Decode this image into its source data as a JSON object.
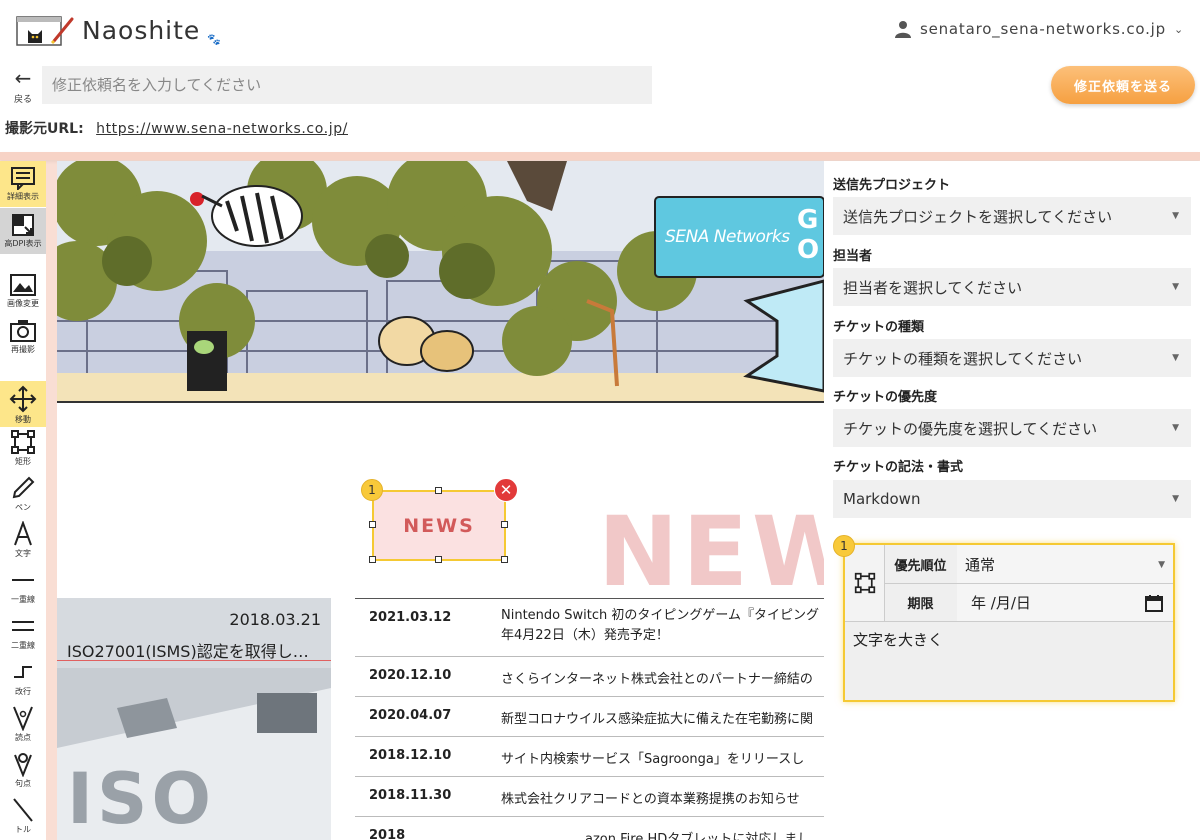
{
  "app": {
    "brand": "Naoshite",
    "user": "senataro_sena-networks.co.jp"
  },
  "toolbar_top": {
    "back_label": "戻る",
    "title_placeholder": "修正依頼名を入力してください",
    "send_label": "修正依頼を送る"
  },
  "source": {
    "label": "撮影元URL:",
    "url": "https://www.sena-networks.co.jp/"
  },
  "tools": [
    {
      "icon": "detail-view-icon",
      "label": "詳細表示"
    },
    {
      "icon": "high-dpi-icon",
      "label": "高DPI表示"
    },
    {
      "icon": "image-change-icon",
      "label": "画像変更"
    },
    {
      "icon": "camera-icon",
      "label": "再撮影"
    },
    {
      "icon": "move-icon",
      "label": "移動"
    },
    {
      "icon": "rectangle-icon",
      "label": "矩形"
    },
    {
      "icon": "pen-icon",
      "label": "ペン"
    },
    {
      "icon": "text-icon",
      "label": "文字"
    },
    {
      "icon": "single-line-icon",
      "label": "一重線"
    },
    {
      "icon": "double-line-icon",
      "label": "二重線"
    },
    {
      "icon": "line-break-icon",
      "label": "改行"
    },
    {
      "icon": "comma-icon",
      "label": "読点"
    },
    {
      "icon": "period-icon",
      "label": "句点"
    },
    {
      "icon": "diagonal-line-icon",
      "label": "トル"
    }
  ],
  "canvas": {
    "hero_sign": "SENA Networks",
    "hero_sign_right": "G",
    "hero_sign_right2": "O",
    "news_heading": "NEWS",
    "news_bg_text": "NEW",
    "feature": {
      "date": "2018.03.21",
      "title": "ISO27001(ISMS)認定を取得し…",
      "image_text": "ISO"
    },
    "news": [
      {
        "date": "2021.03.12",
        "title": "Nintendo Switch 初のタイピングゲーム『タイピング",
        "title2": "年4月22日（木）発売予定！"
      },
      {
        "date": "2020.12.10",
        "title": "さくらインターネット株式会社とのパートナー締結の"
      },
      {
        "date": "2020.04.07",
        "title": "新型コロナウイルス感染症拡大に備えた在宅勤務に関"
      },
      {
        "date": "2018.12.10",
        "title": "サイト内検索サービス「Sagroonga」をリリースし"
      },
      {
        "date": "2018.11.30",
        "title": "株式会社クリアコードとの資本業務提携のお知らせ"
      },
      {
        "date": "2018",
        "title": "azon Fire HDタブレットに対応しまし"
      }
    ]
  },
  "annotation": {
    "number": "1",
    "label": "NEWS"
  },
  "panel": {
    "project_label": "送信先プロジェクト",
    "project_value": "送信先プロジェクトを選択してください",
    "assignee_label": "担当者",
    "assignee_value": "担当者を選択してください",
    "type_label": "チケットの種類",
    "type_value": "チケットの種類を選択してください",
    "priority_label": "チケットの優先度",
    "priority_value": "チケットの優先度を選択してください",
    "format_label": "チケットの記法・書式",
    "format_value": "Markdown",
    "card": {
      "number": "1",
      "priority_key": "優先順位",
      "priority_value": "通常",
      "due_key": "期限",
      "due_value": "年 /月/日",
      "memo": "文字を大きく"
    }
  },
  "colors": {
    "accent": "#f6a041",
    "highlight": "#f5c933",
    "frame": "#f9ded4",
    "active_tool": "#fde68a",
    "close": "#e23a3a"
  }
}
